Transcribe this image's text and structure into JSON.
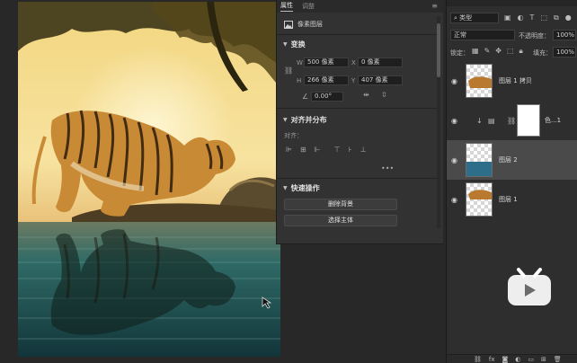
{
  "properties_panel": {
    "tabs": [
      "属性",
      "调整"
    ],
    "layer_kind": "像素图层",
    "transform": {
      "title": "变换",
      "w_label": "W",
      "w_value": "500 像素",
      "x_label": "X",
      "x_value": "0 像素",
      "h_label": "H",
      "h_value": "266 像素",
      "y_label": "Y",
      "y_value": "407 像素",
      "angle_value": "0.00°"
    },
    "align": {
      "title": "对齐并分布",
      "sub_label": "对齐：",
      "more": "•••"
    },
    "quick_actions": {
      "title": "快速操作",
      "remove_bg": "删除背景",
      "select_subject": "选择主体"
    }
  },
  "layers_panel": {
    "filter_kind": "类型",
    "blend_mode": "正常",
    "opacity_label": "不透明度：",
    "opacity_value": "100%",
    "lock_label": "锁定：",
    "fill_label": "填充：",
    "fill_value": "100%",
    "layers": [
      {
        "name": "图层 1 拷贝",
        "visible": true,
        "active": false
      },
      {
        "name": "色...1",
        "visible": true,
        "active": false
      },
      {
        "name": "图层 2",
        "visible": true,
        "active": true
      },
      {
        "name": "图层 1",
        "visible": true,
        "active": false
      }
    ]
  },
  "colors": {
    "panel_bg": "#323232",
    "active_layer": "#4a4a4a",
    "watermark": "#ffffff"
  }
}
